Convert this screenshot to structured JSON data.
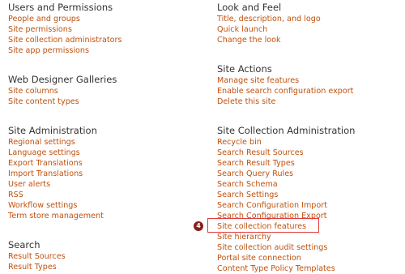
{
  "left": {
    "users_permissions": {
      "heading": "Users and Permissions",
      "links": [
        "People and groups",
        "Site permissions",
        "Site collection administrators",
        "Site app permissions"
      ]
    },
    "web_designer": {
      "heading": "Web Designer Galleries",
      "links": [
        "Site columns",
        "Site content types"
      ]
    },
    "site_admin": {
      "heading": "Site Administration",
      "links": [
        "Regional settings",
        "Language settings",
        "Export Translations",
        "Import Translations",
        "User alerts",
        "RSS",
        "Workflow settings",
        "Term store management"
      ]
    },
    "search": {
      "heading": "Search",
      "links": [
        "Result Sources",
        "Result Types"
      ]
    }
  },
  "right": {
    "look_feel": {
      "heading": "Look and Feel",
      "links": [
        "Title, description, and logo",
        "Quick launch",
        "Change the look"
      ]
    },
    "site_actions": {
      "heading": "Site Actions",
      "links": [
        "Manage site features",
        "Enable search configuration export",
        "Delete this site"
      ]
    },
    "site_collection_admin": {
      "heading": "Site Collection Administration",
      "links": [
        "Recycle bin",
        "Search Result Sources",
        "Search Result Types",
        "Search Query Rules",
        "Search Schema",
        "Search Settings",
        "Search Configuration Import",
        "Search Configuration Export",
        "Site collection features",
        "Site hierarchy",
        "Site collection audit settings",
        "Portal site connection",
        "Content Type Policy Templates"
      ]
    }
  },
  "annotation": {
    "step_number": "4",
    "color": "#e03b3b"
  }
}
